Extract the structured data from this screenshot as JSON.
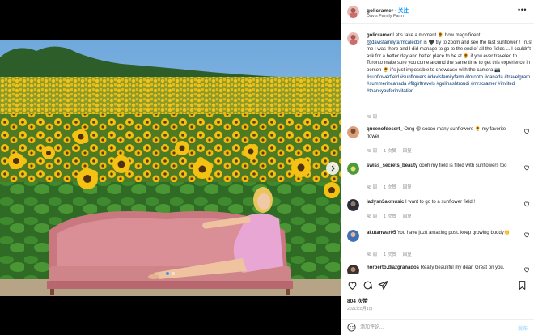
{
  "header": {
    "username": "golicramer",
    "follow_label": "关注",
    "location": "Davis Family Farm",
    "more_icon": "more-horizontal-icon"
  },
  "caption": {
    "username": "golicramer",
    "text_1": "Let's take a moment 🌻 how magnificent",
    "mention": "@davisfamilyfarmcaledon",
    "text_2": "is 🖤 try to zoom and see the last sunflower ! Trust me I was there and I did manage to go to the end of all the fields ... I couldn't ask for a better day and better place to be at 🌻 if you ever traveled to Toronto make sure you come around the same time to get this experience in person 🌻 it's just impossible to showcase with the camera 📷",
    "hashtags": "#sunflowerfield #sunflowers #davisfamilyfarm #toronto #canada #travelgram #summerincanada #fitgirltravels #golihashtroudi #mrscramer #invited #thankyouforinvitation",
    "age": "48 周"
  },
  "comments": [
    {
      "username": "queenofdesert_",
      "text": "Omg 😍 soooo many sunflowers 🌻 my favorite flower",
      "age": "48 周",
      "likes": "1 次赞",
      "reply": "回复"
    },
    {
      "username": "swiss_secrets_beauty",
      "text": "oooh my field is filled with sunflowers too",
      "age": "48 周",
      "likes": "1 次赞",
      "reply": "回复"
    },
    {
      "username": "ladysn3akmusic",
      "text": "I want to go to a sunflower field !",
      "age": "48 周",
      "likes": "1 次赞",
      "reply": "回复"
    },
    {
      "username": "akutanwar05",
      "text": "You have juztt amazing post..keep growing buddy👏",
      "age": "48 周",
      "likes": "1 次赞",
      "reply": "回复"
    },
    {
      "username": "norberto.diazgranados",
      "text": "Really beautiful my dear. Great on you.",
      "age": "",
      "likes": "",
      "reply": ""
    }
  ],
  "actions": {
    "like_icon": "heart-icon",
    "comment_icon": "comment-icon",
    "share_icon": "send-icon",
    "save_icon": "bookmark-icon"
  },
  "likes_count": "804 次赞",
  "post_date": "2021年8月1日",
  "add_comment": {
    "placeholder": "添加评论...",
    "post_label": "发布"
  },
  "colors": {
    "link_blue": "#0095f6",
    "hashtag": "#00376b",
    "muted": "#8e8e8e",
    "sofa_pink": "#d98f95"
  }
}
